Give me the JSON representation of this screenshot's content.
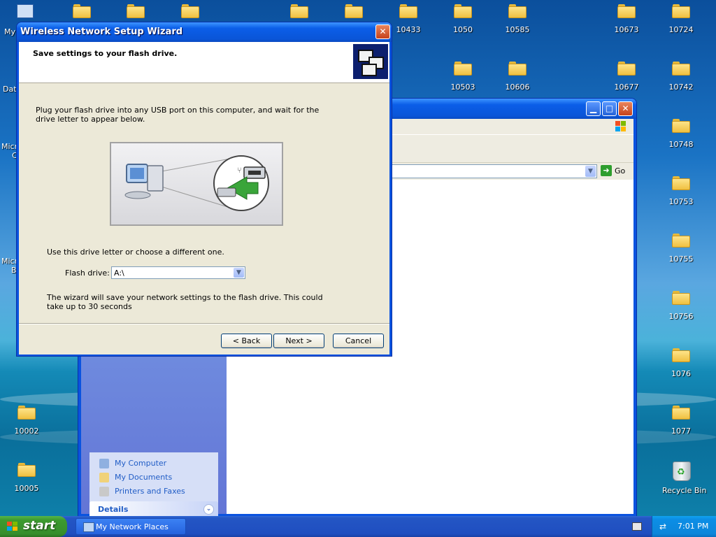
{
  "desktop": {
    "icons_top": [
      "10433",
      "1050",
      "10585",
      "10673",
      "10724"
    ],
    "icons_row2": [
      "10503",
      "10606",
      "10677",
      "10742"
    ],
    "icons_right": [
      "10748",
      "10753",
      "10755",
      "10756",
      "1076",
      "1077"
    ],
    "icons_left": [
      "10002",
      "10005"
    ],
    "partial_labels": [
      "My",
      "Dat",
      "Micr",
      "C",
      "Micr",
      "B"
    ],
    "recycle_bin": "Recycle Bin"
  },
  "explorer": {
    "address_go": "Go",
    "other_places": [
      "My Computer",
      "My Documents",
      "Printers and Faxes"
    ],
    "details_title": "Details"
  },
  "wizard": {
    "title": "Wireless Network Setup Wizard",
    "header_title": "Save settings to your flash drive.",
    "instruction": "Plug your flash drive into any USB port on this computer, and wait for the drive letter to appear below.",
    "drive_prompt": "Use this drive letter or choose a different one.",
    "flash_drive_label": "Flash drive:",
    "flash_drive_value": "A:\\",
    "note": "The wizard will save your network settings to the flash drive. This could take up to 30 seconds",
    "back_button": "< Back",
    "next_button": "Next >",
    "cancel_button": "Cancel"
  },
  "taskbar": {
    "start_label": "start",
    "task_label": "My Network Places",
    "clock": "7:01 PM"
  }
}
